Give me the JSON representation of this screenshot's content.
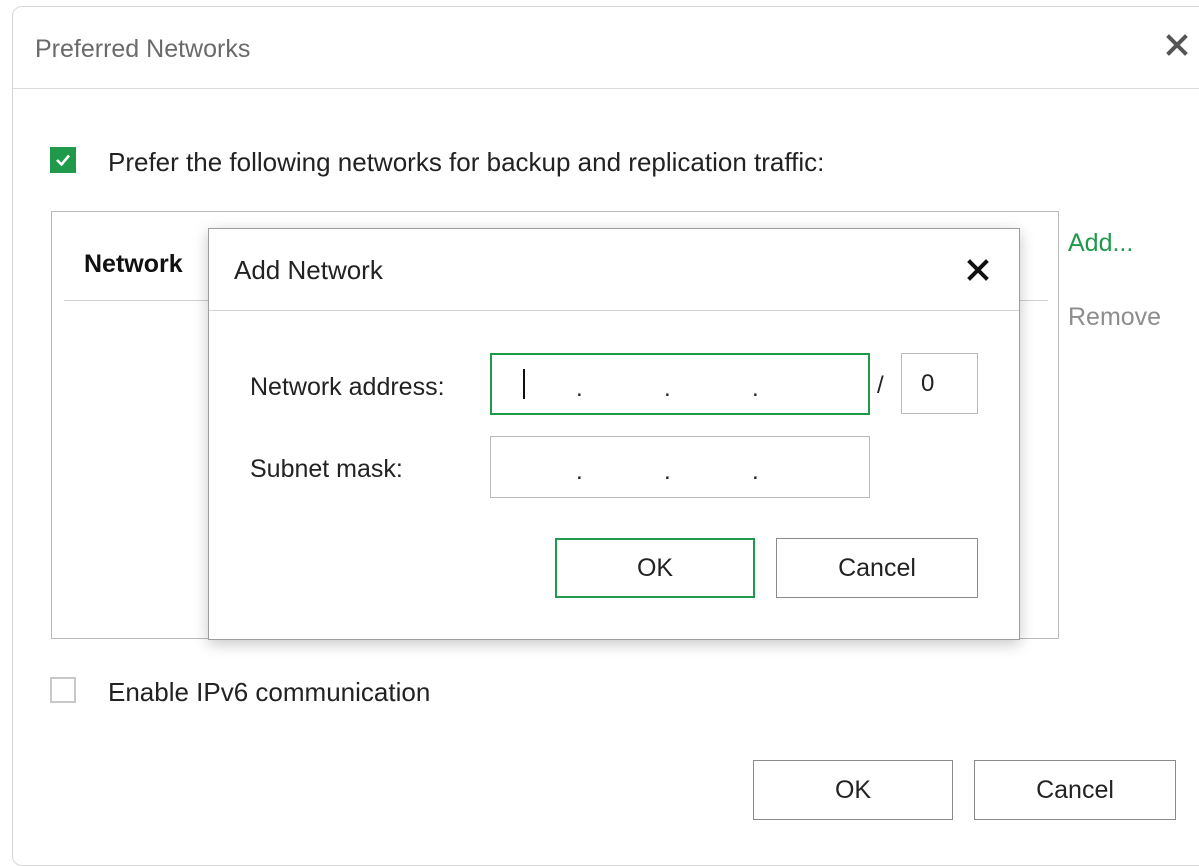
{
  "window": {
    "title": "Preferred Networks",
    "close_icon": "close-icon"
  },
  "prefer_networks": {
    "label": "Prefer the following networks for backup and replication traffic:",
    "checked": true
  },
  "network_list": {
    "column_header": "Network",
    "rows": []
  },
  "side_actions": {
    "add_label": "Add...",
    "remove_label": "Remove"
  },
  "ipv6": {
    "label": "Enable IPv6 communication",
    "checked": false
  },
  "footer": {
    "ok_label": "OK",
    "cancel_label": "Cancel"
  },
  "add_network_dialog": {
    "title": "Add Network",
    "network_address_label": "Network address:",
    "network_address_value": "",
    "ip_separator": ".",
    "prefix_separator": "/",
    "prefix_value": "0",
    "subnet_mask_label": "Subnet mask:",
    "subnet_mask_value": "",
    "ok_label": "OK",
    "cancel_label": "Cancel"
  },
  "colors": {
    "accent": "#1e9a4a",
    "muted_text": "#8d8d8d",
    "border": "#b9b9b9"
  }
}
